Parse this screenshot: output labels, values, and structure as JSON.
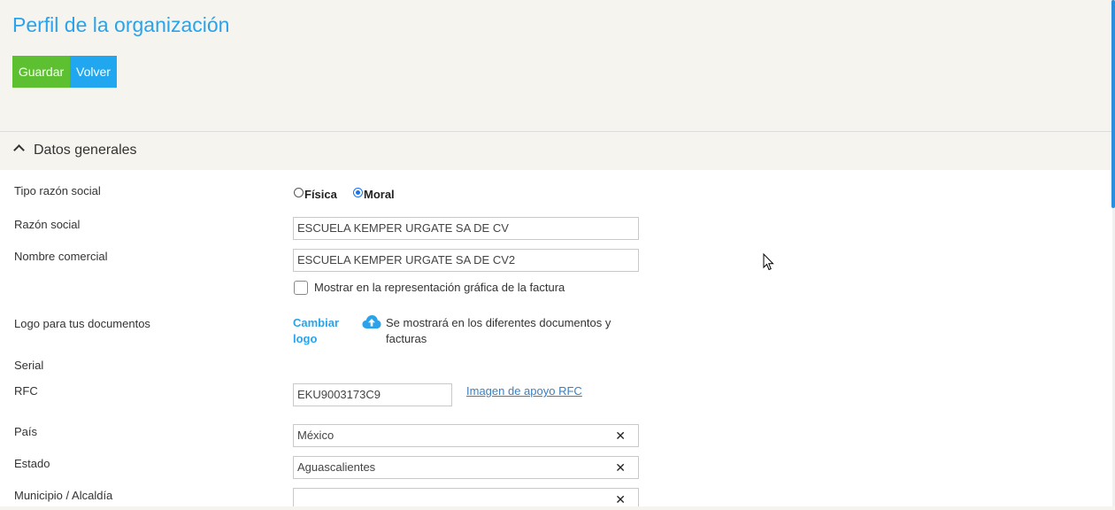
{
  "page": {
    "title": "Perfil de la organización"
  },
  "toolbar": {
    "save_label": "Guardar",
    "back_label": "Volver"
  },
  "section": {
    "title": "Datos generales"
  },
  "form": {
    "tipo_razon_social": {
      "label": "Tipo razón social",
      "options": [
        "Física",
        "Moral"
      ],
      "selected": "Moral"
    },
    "razon_social": {
      "label": "Razón social",
      "value": "ESCUELA KEMPER URGATE SA DE CV"
    },
    "nombre_comercial": {
      "label": "Nombre comercial",
      "value": "ESCUELA KEMPER URGATE SA DE CV2"
    },
    "mostrar_factura": {
      "label": "Mostrar en la representación gráfica de la factura",
      "checked": false
    },
    "logo": {
      "label": "Logo para tus documentos",
      "change_line1": "Cambiar",
      "change_line2": "logo",
      "hint_line1": "Se mostrará en los diferentes documentos y",
      "hint_line2": "facturas"
    },
    "serial": {
      "label": "Serial"
    },
    "rfc": {
      "label": "RFC",
      "value": "EKU9003173C9",
      "help_link": "Imagen de apoyo RFC"
    },
    "pais": {
      "label": "País",
      "value": "México"
    },
    "estado": {
      "label": "Estado",
      "value": "Aguascalientes"
    },
    "municipio": {
      "label": "Municipio / Alcaldía",
      "value": ""
    },
    "clear_symbol": "✕"
  },
  "colors": {
    "accent": "#2ba3ea",
    "save": "#5cc031",
    "back": "#21a7ef",
    "background": "#f5f4ee"
  },
  "icons": [
    "chevron-up-icon",
    "cloud-upload-icon",
    "close-icon",
    "mouse-cursor-icon"
  ]
}
